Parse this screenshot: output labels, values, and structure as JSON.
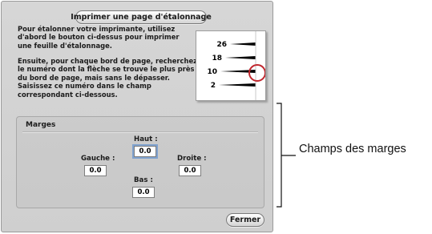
{
  "dialog": {
    "calibrate_button": "Imprimer une page d'étalonnage",
    "instructions_1": "Pour étalonner votre imprimante, utilisez\nd'abord le bouton ci-dessus pour imprimer\nune feuille d'étalonnage.",
    "instructions_2": "Ensuite, pour chaque bord de page, recherchez\nle numéro dont la flèche se trouve le plus près\ndu bord de page, mais sans le dépasser.\nSaisissez ce numéro dans le champ\ncorrespondant ci-dessous.",
    "illustration": {
      "numbers": [
        "26",
        "18",
        "10",
        "2"
      ],
      "highlight_color": "#c0262d"
    },
    "margins": {
      "title": "Marges",
      "top_label": "Haut :",
      "top_value": "0.0",
      "left_label": "Gauche :",
      "left_value": "0.0",
      "right_label": "Droite :",
      "right_value": "0.0",
      "bottom_label": "Bas :",
      "bottom_value": "0.0"
    },
    "close_button": "Fermer"
  },
  "callout": {
    "label": "Champs des marges"
  }
}
